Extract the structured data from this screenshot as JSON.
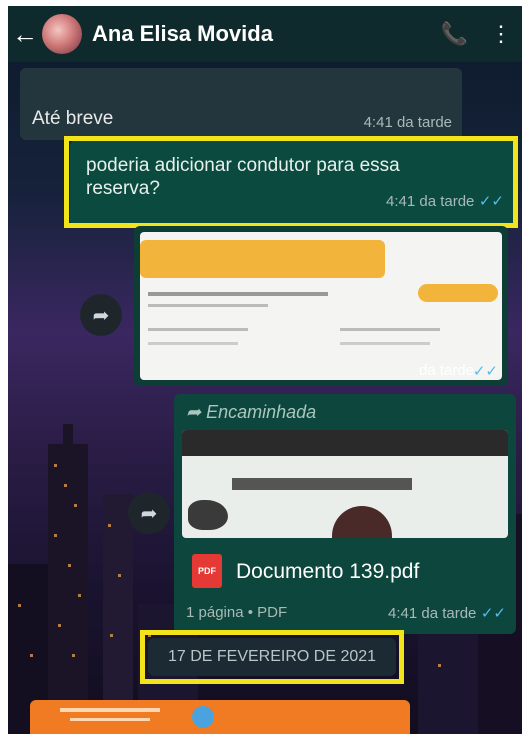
{
  "header": {
    "back_icon": "arrow-left-icon",
    "contact_name": "Ana Elisa Movida",
    "call_icon": "add-call-icon",
    "menu_icon": "more-vert-icon"
  },
  "messages": {
    "m1": {
      "text": "Até breve",
      "time": "4:41 da tarde"
    },
    "m2": {
      "text": "poderia adicionar condutor para essa reserva?",
      "time": "4:41 da tarde"
    },
    "m3": {
      "time": "da tarde"
    },
    "m4": {
      "forward_label": "Encaminhada",
      "file_name": "Documento 139.pdf",
      "meta": "1 página • PDF",
      "time": "4:41 da tarde"
    }
  },
  "date_chip": "17 DE FEVEREIRO DE 2021",
  "colors": {
    "highlight": "#f2e31a",
    "sent_bubble": "#0b4a3f",
    "received_bubble": "#24363d",
    "appbar": "#0f2a2d"
  }
}
